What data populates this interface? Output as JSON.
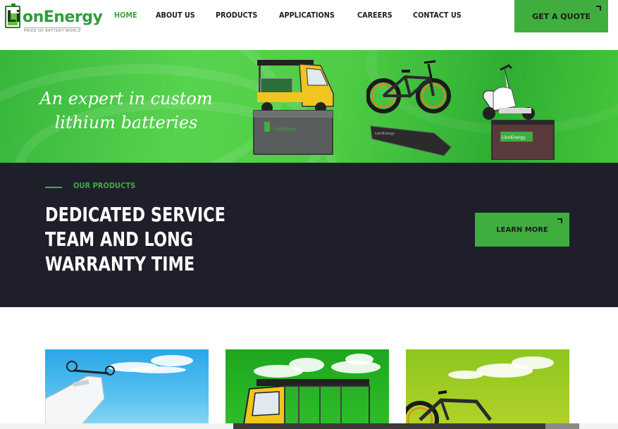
{
  "brand": {
    "name_prefix": "Li",
    "name_suffix": "onEnergy",
    "tagline": "PRIDE OF BATTERY WORLD"
  },
  "nav": {
    "items": [
      {
        "label": "HOME",
        "active": true
      },
      {
        "label": "ABOUT US",
        "active": false
      },
      {
        "label": "PRODUCTS",
        "active": false
      },
      {
        "label": "APPLICATIONS",
        "active": false
      },
      {
        "label": "CAREERS",
        "active": false
      },
      {
        "label": "CONTACT US",
        "active": false
      }
    ],
    "quote_button": "GET A QUOTE"
  },
  "hero": {
    "line1": "An expert in custom",
    "line2": "lithium batteries",
    "battery_label_1": "LionEnergy",
    "battery_label_2": "LionEnergy",
    "battery_label_3": "LionEnergy"
  },
  "products_section": {
    "eyebrow": "OUR PRODUCTS",
    "headline_line1": "DEDICATED SERVICE",
    "headline_line2": "TEAM AND LONG",
    "headline_line3": "WARRANTY TIME",
    "button": "LEARN MORE"
  },
  "colors": {
    "accent_green": "#3fae3f",
    "dark_bg": "#1f1f2b",
    "active_nav": "#3aa43a"
  },
  "icons": [
    "corner-arrow-icon",
    "battery-logo-icon"
  ]
}
